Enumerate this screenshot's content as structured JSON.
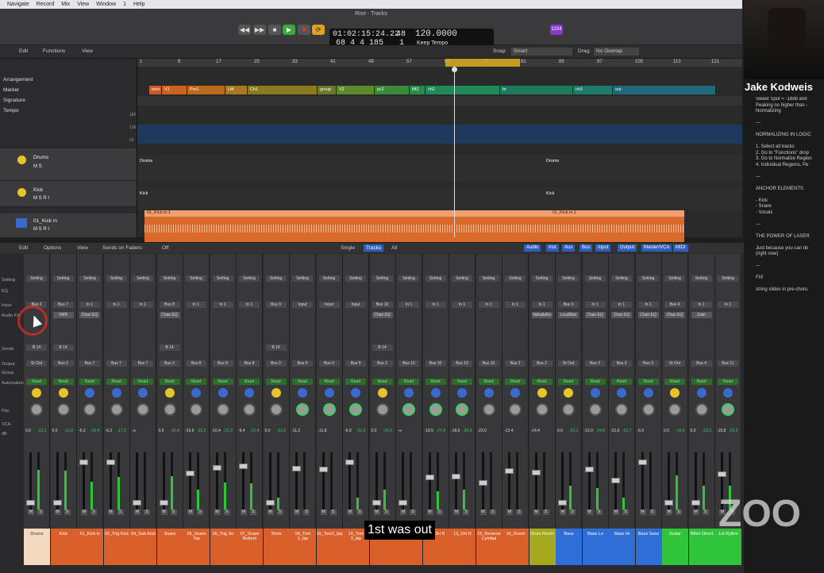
{
  "menubar": {
    "items": [
      "Navigate",
      "Record",
      "Mix",
      "View",
      "Window",
      "1",
      "Help"
    ]
  },
  "window": {
    "title": "Rise - Tracks"
  },
  "transport": {
    "timecode": "01:02:15:24.22",
    "bars": "68  4  4  185",
    "bar_beat_top": "48",
    "bar_beat_bottom": "1",
    "tempo": "120.0000",
    "tempo_mode": "Keep Tempo",
    "cpu_badge": "1234"
  },
  "toolbar": {
    "edit": "Edit",
    "functions": "Functions",
    "view": "View",
    "snap_label": "Snap:",
    "snap_value": "Smart",
    "drag_label": "Drag:",
    "drag_value": "No Overlap"
  },
  "global_tracks": [
    "Arrangement",
    "Marker",
    "Signature",
    "Tempo"
  ],
  "tempo_values": [
    "180",
    "120",
    "60"
  ],
  "ruler": [
    "1",
    "9",
    "17",
    "25",
    "33",
    "41",
    "49",
    "57",
    "65",
    "73",
    "81",
    "89",
    "97",
    "105",
    "113",
    "121"
  ],
  "markers": [
    {
      "label": "intro",
      "color": "#c85a2a"
    },
    {
      "label": "V1",
      "color": "#c8641e"
    },
    {
      "label": "Pre1",
      "color": "#b86a1a"
    },
    {
      "label": "Lift",
      "color": "#a87a20"
    },
    {
      "label": "Ch1",
      "color": "#8a7a1e"
    },
    {
      "label": "group",
      "color": "#6a7a2a"
    },
    {
      "label": "V2",
      "color": "#5a8a2a"
    },
    {
      "label": "pc2",
      "color": "#3a8a3a"
    },
    {
      "label": "lift2",
      "color": "#2a8a4a"
    },
    {
      "label": "ch2",
      "color": "#1e8a5a"
    },
    {
      "label": "br",
      "color": "#1e7a5a"
    },
    {
      "label": "ch3",
      "color": "#1e7a6a"
    },
    {
      "label": "out",
      "color": "#1e6a7a"
    }
  ],
  "tracks": [
    {
      "name": "Drums",
      "sub": "M  S"
    },
    {
      "name": "Kick",
      "sub": "M  S   R  I"
    },
    {
      "name": "01_Kick in",
      "sub": "M  S   R  I"
    }
  ],
  "regions": {
    "drums_a": "Drums",
    "drums_b": "Drums",
    "kick_a": "Kick",
    "kick_b": "Kick",
    "kickin_a": "01_Kick in.1",
    "kickin_b": "01_Kick in.1"
  },
  "mixer": {
    "edit": "Edit",
    "options": "Options",
    "view": "View",
    "sends_label": "Sends on Faders:",
    "sends_value": "Off",
    "modes": [
      "Single",
      "Tracks",
      "All"
    ],
    "filters": [
      "Audio",
      "Inst",
      "Aux",
      "Bus",
      "Input",
      "Output",
      "Master/VCA",
      "MIDI"
    ]
  },
  "row_labels": [
    "Setting",
    "EQ",
    "Input",
    "Audio FX",
    "Sends",
    "Output",
    "Group",
    "Automation",
    "",
    "Pan",
    "VCA",
    "dB"
  ],
  "strips": [
    {
      "setting": "Setting",
      "input": "Bus 2",
      "fx": "",
      "send": "B 14",
      "output": "St Out",
      "auto": "Read",
      "db": "0.0",
      "peak": "-12.1",
      "name": "Drums",
      "color": "#f3d9bf",
      "pan": 0
    },
    {
      "setting": "Setting",
      "input": "Bus 7",
      "fx": "VMR",
      "send": "B 14",
      "output": "Bus 2",
      "auto": "Read",
      "db": "0.0",
      "peak": "-12.8",
      "name": "Kick",
      "color": "#d9602a",
      "pan": 0
    },
    {
      "setting": "Setting",
      "input": "In 1",
      "fx": "Chan EQ",
      "send": "",
      "output": "Bus 7",
      "auto": "Read",
      "db": "-6.2",
      "peak": "-20.4",
      "name": "01_Kick In",
      "color": "#d9602a",
      "pan": 0
    },
    {
      "setting": "Setting",
      "input": "In 1",
      "fx": "",
      "send": "",
      "output": "Bus 7",
      "auto": "Read",
      "db": "-6.2",
      "peak": "-17.2",
      "name": "02_Trig Kick",
      "color": "#d9602a",
      "pan": 0
    },
    {
      "setting": "Setting",
      "input": "In 1",
      "fx": "",
      "send": "",
      "output": "Bus 7",
      "auto": "Read",
      "db": "-∞",
      "peak": "",
      "name": "04_Sub Kick",
      "color": "#d9602a",
      "pan": 0
    },
    {
      "setting": "Setting",
      "input": "Bus 8",
      "fx": "Chan EQ",
      "send": "B 14",
      "output": "Bus 2",
      "auto": "Read",
      "db": "0.0",
      "peak": "-16.4",
      "name": "Snare",
      "color": "#d9602a",
      "pan": 0
    },
    {
      "setting": "Setting",
      "input": "In 1",
      "fx": "",
      "send": "",
      "output": "Bus 8",
      "auto": "Read",
      "db": "-15.6",
      "peak": "-26.2",
      "name": "05_Snare Top",
      "color": "#d9602a",
      "pan": 0
    },
    {
      "setting": "Setting",
      "input": "In 1",
      "fx": "",
      "send": "",
      "output": "Bus 8",
      "auto": "Read",
      "db": "-10.4",
      "peak": "-21.3",
      "name": "06_Trig Sn",
      "color": "#d9602a",
      "pan": 0
    },
    {
      "setting": "Setting",
      "input": "In 1",
      "fx": "",
      "send": "",
      "output": "Bus 8",
      "auto": "Read",
      "db": "-9.4",
      "peak": "-21.4",
      "name": "07_Snare Bottom",
      "color": "#d9602a",
      "pan": 0
    },
    {
      "setting": "Setting",
      "input": "Bus 9",
      "fx": "",
      "send": "B 14",
      "output": "Bus 2",
      "auto": "Read",
      "db": "0.0",
      "peak": "-31.6",
      "name": "Toms",
      "color": "#d9602a",
      "pan": 0
    },
    {
      "setting": "Setting",
      "input": "Input",
      "fx": "",
      "send": "",
      "output": "Bus 9",
      "auto": "Read",
      "db": "-11.2",
      "peak": "",
      "name": "09_Tom 1_bip",
      "color": "#d9602a",
      "pan": 41
    },
    {
      "setting": "Setting",
      "input": "Input",
      "fx": "",
      "send": "",
      "output": "Bus 9",
      "auto": "Read",
      "db": "-11.8",
      "peak": "",
      "name": "10_Tom2_bip",
      "color": "#d9602a",
      "pan": -30
    },
    {
      "setting": "Setting",
      "input": "Input",
      "fx": "",
      "send": "",
      "output": "Bus 9",
      "auto": "Read",
      "db": "-6.0",
      "peak": "-31.6",
      "name": "10_Tom 3_bip",
      "color": "#d9602a",
      "pan": -45
    },
    {
      "setting": "Setting",
      "input": "Bus 10",
      "fx": "Chan EQ",
      "send": "B 14",
      "output": "Bus 2",
      "auto": "Read",
      "db": "0.0",
      "peak": "-25.9",
      "name": "OH",
      "color": "#d9602a",
      "pan": 0
    },
    {
      "setting": "Setting",
      "input": "In 1",
      "fx": "",
      "send": "",
      "output": "Bus 10",
      "auto": "Read",
      "db": "-∞",
      "peak": "",
      "name": "11_OH L",
      "color": "#d9602a",
      "pan": -36
    },
    {
      "setting": "Setting",
      "input": "In 1",
      "fx": "",
      "send": "",
      "output": "Bus 10",
      "auto": "Read",
      "db": "-18.5",
      "peak": "-27.4",
      "name": "12_OH R",
      "color": "#d9602a",
      "pan": -64
    },
    {
      "setting": "Setting",
      "input": "In 1",
      "fx": "",
      "send": "",
      "output": "Bus 10",
      "auto": "Read",
      "db": "-18.0",
      "peak": "-25.9",
      "name": "13_OH R",
      "color": "#d9602a",
      "pan": 63
    },
    {
      "setting": "Setting",
      "input": "In 1",
      "fx": "",
      "send": "",
      "output": "Bus 10",
      "auto": "Read",
      "db": "-23.0",
      "peak": "",
      "name": "15_Reverse Cymbal",
      "color": "#d9602a",
      "pan": 0
    },
    {
      "setting": "Setting",
      "input": "In 1",
      "fx": "",
      "send": "",
      "output": "Bus 2",
      "auto": "Read",
      "db": "-13.4",
      "peak": "",
      "name": "14_Room",
      "color": "#d9602a",
      "pan": 0
    },
    {
      "setting": "Setting",
      "input": "In 1",
      "fx": "ValhallaRo",
      "send": "",
      "output": "Bus 2",
      "auto": "Read",
      "db": "-14.4",
      "peak": "",
      "name": "Drum Room",
      "color": "#a6a81e",
      "pan": 0
    },
    {
      "setting": "Setting",
      "input": "Bus 3",
      "fx": "LoudMax",
      "send": "",
      "output": "St Out",
      "auto": "Read",
      "db": "0.0",
      "peak": "-23.1",
      "name": "Bass",
      "color": "#2f6ed6",
      "pan": 0
    },
    {
      "setting": "Setting",
      "input": "In 1",
      "fx": "Chan EQ",
      "send": "",
      "output": "Bus 3",
      "auto": "Read",
      "db": "-12.0",
      "peak": "-24.8",
      "name": "Bass Lo",
      "color": "#2f6ed6",
      "pan": 0
    },
    {
      "setting": "Setting",
      "input": "In 1",
      "fx": "Chan EQ",
      "send": "",
      "output": "Bus 3",
      "auto": "Read",
      "db": "-21.6",
      "peak": "-31.7",
      "name": "Bass Hi",
      "color": "#2f6ed6",
      "pan": 0
    },
    {
      "setting": "Setting",
      "input": "In 1",
      "fx": "Chan EQ",
      "send": "",
      "output": "Bus 3",
      "auto": "Read",
      "db": "-6.0",
      "peak": "",
      "name": "Bass Sans",
      "color": "#2f6ed6",
      "pan": 0
    },
    {
      "setting": "Setting",
      "input": "Bus 4",
      "fx": "Chan EQ",
      "send": "",
      "output": "St Out",
      "auto": "Read",
      "db": "0.0",
      "peak": "-16.0",
      "name": "Guitar",
      "color": "#2fc43a",
      "pan": 0
    },
    {
      "setting": "Setting",
      "input": "In 1",
      "fx": "Gain",
      "send": "",
      "output": "Bus 4",
      "auto": "Read",
      "db": "0.0",
      "peak": "-23.3",
      "name": "Rthm Direct",
      "color": "#2fc43a",
      "pan": 0
    },
    {
      "setting": "Setting",
      "input": "In 1",
      "fx": "",
      "send": "",
      "output": "Bus 11",
      "auto": "Read",
      "db": "-15.8",
      "peak": "-23.3",
      "name": "1st Rythm",
      "color": "#2fc43a",
      "pan": -64
    }
  ],
  "notes": {
    "presenter": "Jake Kodweis",
    "lines": [
      "Sweet Spot = -18db and",
      "Peaking no higher than -",
      "Normalizing",
      "",
      "---",
      "",
      "NORMALIZING IN LOGIC",
      "",
      "1. Select all tracks",
      "2. Go to \"Functions\" drop",
      "3. Go to Normalize Region",
      "4. Individual Regions, Pe",
      "",
      "---",
      "",
      "ANCHOR ELEMENTS",
      "",
      "- Kick",
      "- Snare",
      "- Vocals",
      "",
      "---",
      "",
      "THE POWER OF LASER",
      "",
      "Just because you can do",
      "(right now)",
      "",
      "---",
      "",
      "FIX",
      "",
      "string slides in pre-choru"
    ]
  },
  "caption": "1st was out",
  "watermark": "ZOO",
  "colors": {
    "accent": "#3b6fd9",
    "play": "#3aa83a",
    "record": "#d93a2a",
    "cycle": "#e0a020"
  }
}
